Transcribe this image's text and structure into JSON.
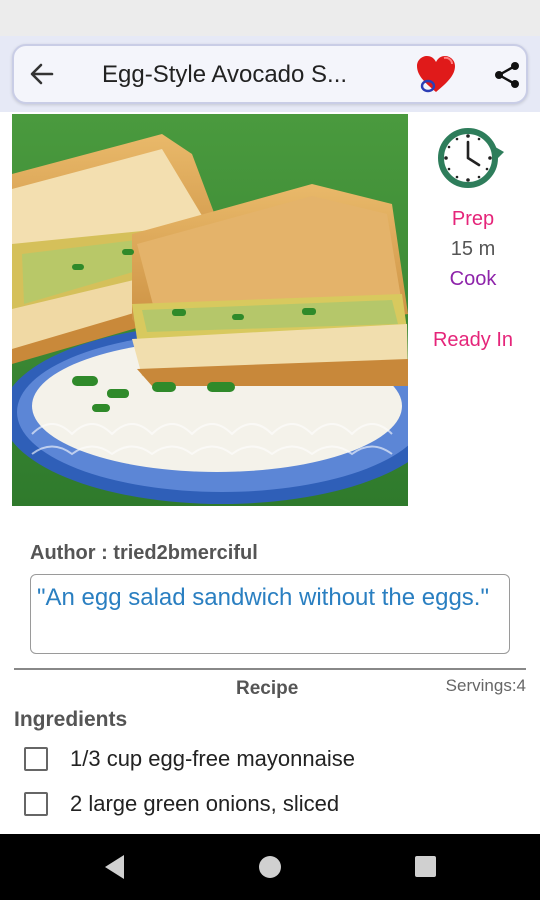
{
  "status_bar": {
    "left": "",
    "right": ""
  },
  "app_bar": {
    "title": "Egg-Style Avocado S..."
  },
  "icons": {
    "back": "arrow-left-icon",
    "favorite": "heart-icon",
    "share": "share-icon",
    "clock": "clock-icon"
  },
  "times": {
    "prep_label": "Prep",
    "prep_value": "15 m",
    "cook_label": "Cook",
    "ready_label": "Ready In"
  },
  "author": "Author : tried2bmerciful",
  "description": "\"An egg salad sandwich without the eggs.\"",
  "recipe": {
    "label": "Recipe",
    "servings": "Servings:4",
    "ingredients_title": "Ingredients",
    "ingredients": [
      "1/3 cup egg-free mayonnaise",
      "2 large green onions, sliced"
    ]
  },
  "colors": {
    "accent_pink": "#e5257a",
    "accent_purple": "#8e24aa",
    "description_blue": "#2a7fc1",
    "clock_green": "#2e7d5b"
  }
}
